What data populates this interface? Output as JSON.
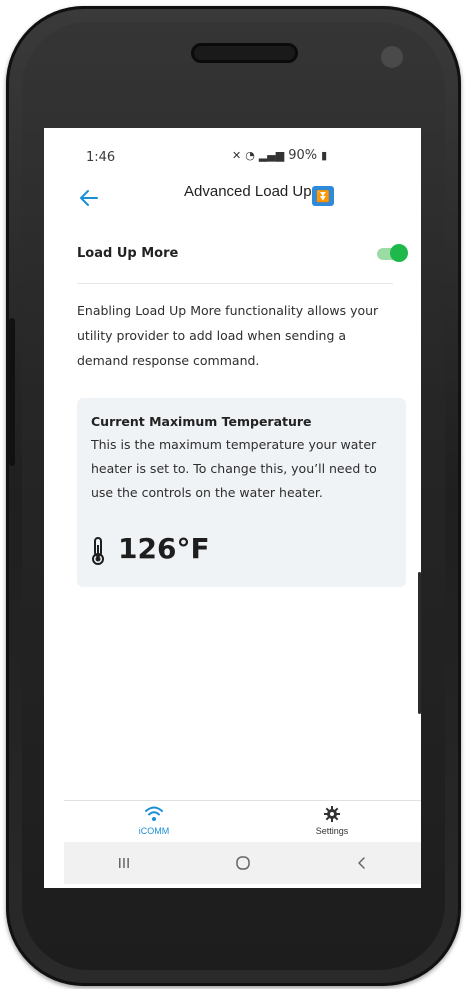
{
  "status_bar": {
    "time": "1:46",
    "battery": "90%"
  },
  "header": {
    "title": "Advanced Load Up",
    "badge_icon": "double-down-arrow-badge-icon"
  },
  "settings_row": {
    "label": "Load Up More",
    "toggle_on": true
  },
  "description": "Enabling Load Up More functionality allows your utility provider to add load when sending a demand response command.",
  "info_card": {
    "title": "Current Maximum Temperature",
    "text": "This is the maximum temperature your water heater is set to. To change this, you’ll need to use the controls on the water heater.",
    "temperature": "126°F"
  },
  "bottom_nav": {
    "items": [
      {
        "label": "iCOMM",
        "icon": "wifi-icon",
        "active": true
      },
      {
        "label": "Settings",
        "icon": "gear-icon",
        "active": false
      }
    ]
  },
  "colors": {
    "accent": "#1b8fd6",
    "toggle_on": "#1fb84a",
    "card_bg": "#f0f3f6"
  }
}
